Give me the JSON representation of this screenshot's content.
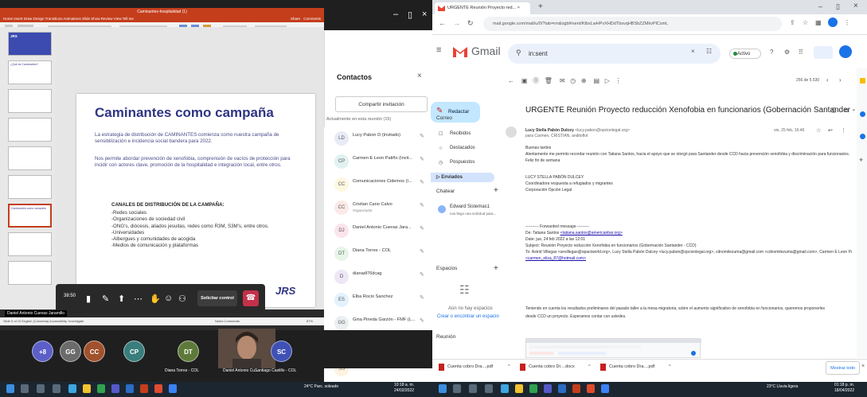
{
  "teams": {
    "window_min": "–",
    "window_max": "▯",
    "window_close": "×"
  },
  "ppt": {
    "title_bar": "Caminantes-hospitalidad (1)",
    "menu": "Home   Insert   Draw   Design   Transitions   Animations   Slide Show   Review   View   Tell me",
    "share": "Share",
    "comments": "Comments",
    "thumb_labels": [
      "¿Qué es Caminantes?",
      "",
      "",
      "",
      "",
      "Caminantes como campaña",
      ""
    ],
    "status_left": "Slide 5 of 10   English (Colombia)   Accessibility: Investigate",
    "status_right": "Notes   Comments",
    "zoom": "87%"
  },
  "slide": {
    "title": "Caminantes como campaña",
    "p1": "La estrategia de distribución de CAMINANTES comienza como nuestra campaña de sensibilización e incidencia social bandera para 2022.",
    "p2": "Nos permite abordar prevención de xenofobia, comprensión de vacíos de protección para incidir con actores clave, promoción de la hospitalidad e integración local, entre otros.",
    "canales_title": "CANALES DE DISTRIBUCIÓN DE LA CAMPAÑA:",
    "canales": [
      "-Redes sociales",
      "-Organizaciones de sociedad civil",
      "-ONG's, diócesis, aliados jesuitas, redes como R3M, S3M's, entre otros.",
      "-Universidades",
      "-Albergues y comunidades de acogida",
      "-Medios de comunicación y plataformas"
    ],
    "logo": "JRS",
    "logo_thumb": "JRS"
  },
  "meeting_bar": {
    "time": "38:50",
    "solicitar": "Solicitar control"
  },
  "presenter_label": "Daniel Antonio Cuevas Jaramillo",
  "contacts": {
    "header": "Contactos",
    "close": "×",
    "share_invite": "Compartir invitación",
    "in_meeting": "Actualmente en esta reunión (15)",
    "people": [
      {
        "initials": "LD",
        "name": "Lucy Pabon D (Invitado)",
        "sub": "",
        "color": "#e8eaf6"
      },
      {
        "initials": "CP",
        "name": "Carmen E Leon Patiño (Invit...",
        "sub": "",
        "color": "#e0f2f1"
      },
      {
        "initials": "CC",
        "name": "Comunicaciones Cidemos (I...",
        "sub": "",
        "color": "#fff8e1"
      },
      {
        "initials": "CC",
        "name": "Cristian Cano Calvo",
        "sub": "Organizador",
        "color": "#fbe9e7"
      },
      {
        "initials": "DJ",
        "name": "Daniel Antonio Cuevas Jara...",
        "sub": "",
        "color": "#fce4ec"
      },
      {
        "initials": "DT",
        "name": "Diana Torres - COL",
        "sub": "",
        "color": "#e8f5e9"
      },
      {
        "initials": "D",
        "name": "dianadl76dcag",
        "sub": "",
        "color": "#ede7f6"
      },
      {
        "initials": "ES",
        "name": "Elba Rocio Sanchez",
        "sub": "",
        "color": "#e3f2fd"
      },
      {
        "initials": "GG",
        "name": "Gina Pineda Garzón - FMF (L...",
        "sub": "",
        "color": "#eceff1"
      },
      {
        "initials": "VG",
        "name": "Guzman, Viviana (COL)",
        "sub": "",
        "color": "#f3e5f5"
      },
      {
        "initials": "SS",
        "name": "Sandra Rodriguez Santande...",
        "sub": "",
        "color": "#fff3e0"
      }
    ]
  },
  "strip": {
    "bubbles": [
      {
        "label": "+8",
        "color": "#5b5fc7"
      },
      {
        "label": "GG",
        "color": "#6b6b6b"
      },
      {
        "label": "CC",
        "color": "#a0522d"
      },
      {
        "label": "CP",
        "color": "#3a7d7d"
      },
      {
        "label": "DT",
        "color": "#5e7a3a"
      },
      {
        "label": "SC",
        "color": "#3f51b5"
      }
    ],
    "name_dt": "Diana Torres - COL",
    "name_face": "Daniel Antonio Cu...",
    "name_sc": "Santiago Castillo - COL"
  },
  "taskbar_left": {
    "weather": "24°C  Parc. soleado",
    "time": "10:18 a. m.",
    "date": "24/02/2022"
  },
  "taskbar_right": {
    "weather": "23°C  Lluvia ligera",
    "time": "01:18 p. m.",
    "date": "18/04/2022"
  },
  "chrome": {
    "tab_title": "URGENTE Reunión Proyecto red... ×",
    "new_tab": "+",
    "url": "mail.google.com/mail/u/0/?tab=rm&ogbl#sent/KtbxLwHPvXHDdTbsvqHBSbZZMkvPlCsmL"
  },
  "gmail": {
    "logo": "Gmail",
    "search": "in:sent",
    "status": "Activo",
    "compose": "Redactar",
    "nav_section": "Correo",
    "nav": [
      "Recibidos",
      "Destacados",
      "Pospuestos",
      "Enviados"
    ],
    "chat_section": "Chatear",
    "chat_contact": "Edward Sistemas1",
    "chat_preview": "nos llego una solicitud para...",
    "spaces_section": "Espacios",
    "spaces_empty": "Aún no hay espacios",
    "spaces_link": "Crear o encontrar un espacio",
    "meeting_section": "Reunión",
    "counter": "256 de 5.530",
    "subject": "URGENTE Reunión Proyecto reducción Xenofobia en funcionarios (Gobernación Santander - CCD)",
    "sender": "Lucy Stella Pabón Dulcey",
    "sender_email": "<lucy.pabon@opcionlegal.org>",
    "to_line": "para Carmen, CRISTIAN, anditoflot",
    "date_line": "vie, 25 feb, 16:46",
    "body": [
      "Buenas tardes",
      "Atentamente me permito recordar reunión con Tatiana Santos, hacia el apoyo que se otorgó para Santander desde CCD hacia prevención xenofobia y discriminación para funcionarios.",
      "Feliz fin de semana",
      "",
      "LUCY STELLA PABÓN DULCEY",
      "Coordinadora respuesta a refugiados y migrantes",
      "Corporación Opción Legal"
    ],
    "fw_header": "---------- Forwarded message ---------",
    "fw_from_label": "De: Tatiana Santos ",
    "fw_from_email": "<tatiana.santos@americanbar.org>",
    "fw_date": "Date: jue, 24 feb 2022 a las 12:01",
    "fw_subject": "Subject: Reunión Proyecto reducción Xenofobia en funcionarios (Gobernación Santander - CCD)",
    "fw_to": "To: Astrid Villegas <sevillegas@opactworld.org>, Lucy Stella Pabón Dulcey <lucy.pabon@opcionlegal.org>, cdnomilezuma@gmail.com <cdnomilezuma@gmail.com>, Carmen E Leon Patiño",
    "fw_cc": "<carmen_eliza_87@hotmail.com>",
    "body2": "Teniendo en cuenta los resultados preliminares del pasado taller a la mesa migratoria, sobre el aumento significativo de xenofobia en funcionarios, queremos proponerles",
    "body3": "desde CCD un proyecto. Esperamos contar con ustedes."
  },
  "downloads": {
    "items": [
      "Cuenta cobro Dra....pdf",
      "Cuenta cobro Dr....docx",
      "Cuenta cobro Dra....pdf"
    ],
    "show_all": "Mostrar todo"
  }
}
